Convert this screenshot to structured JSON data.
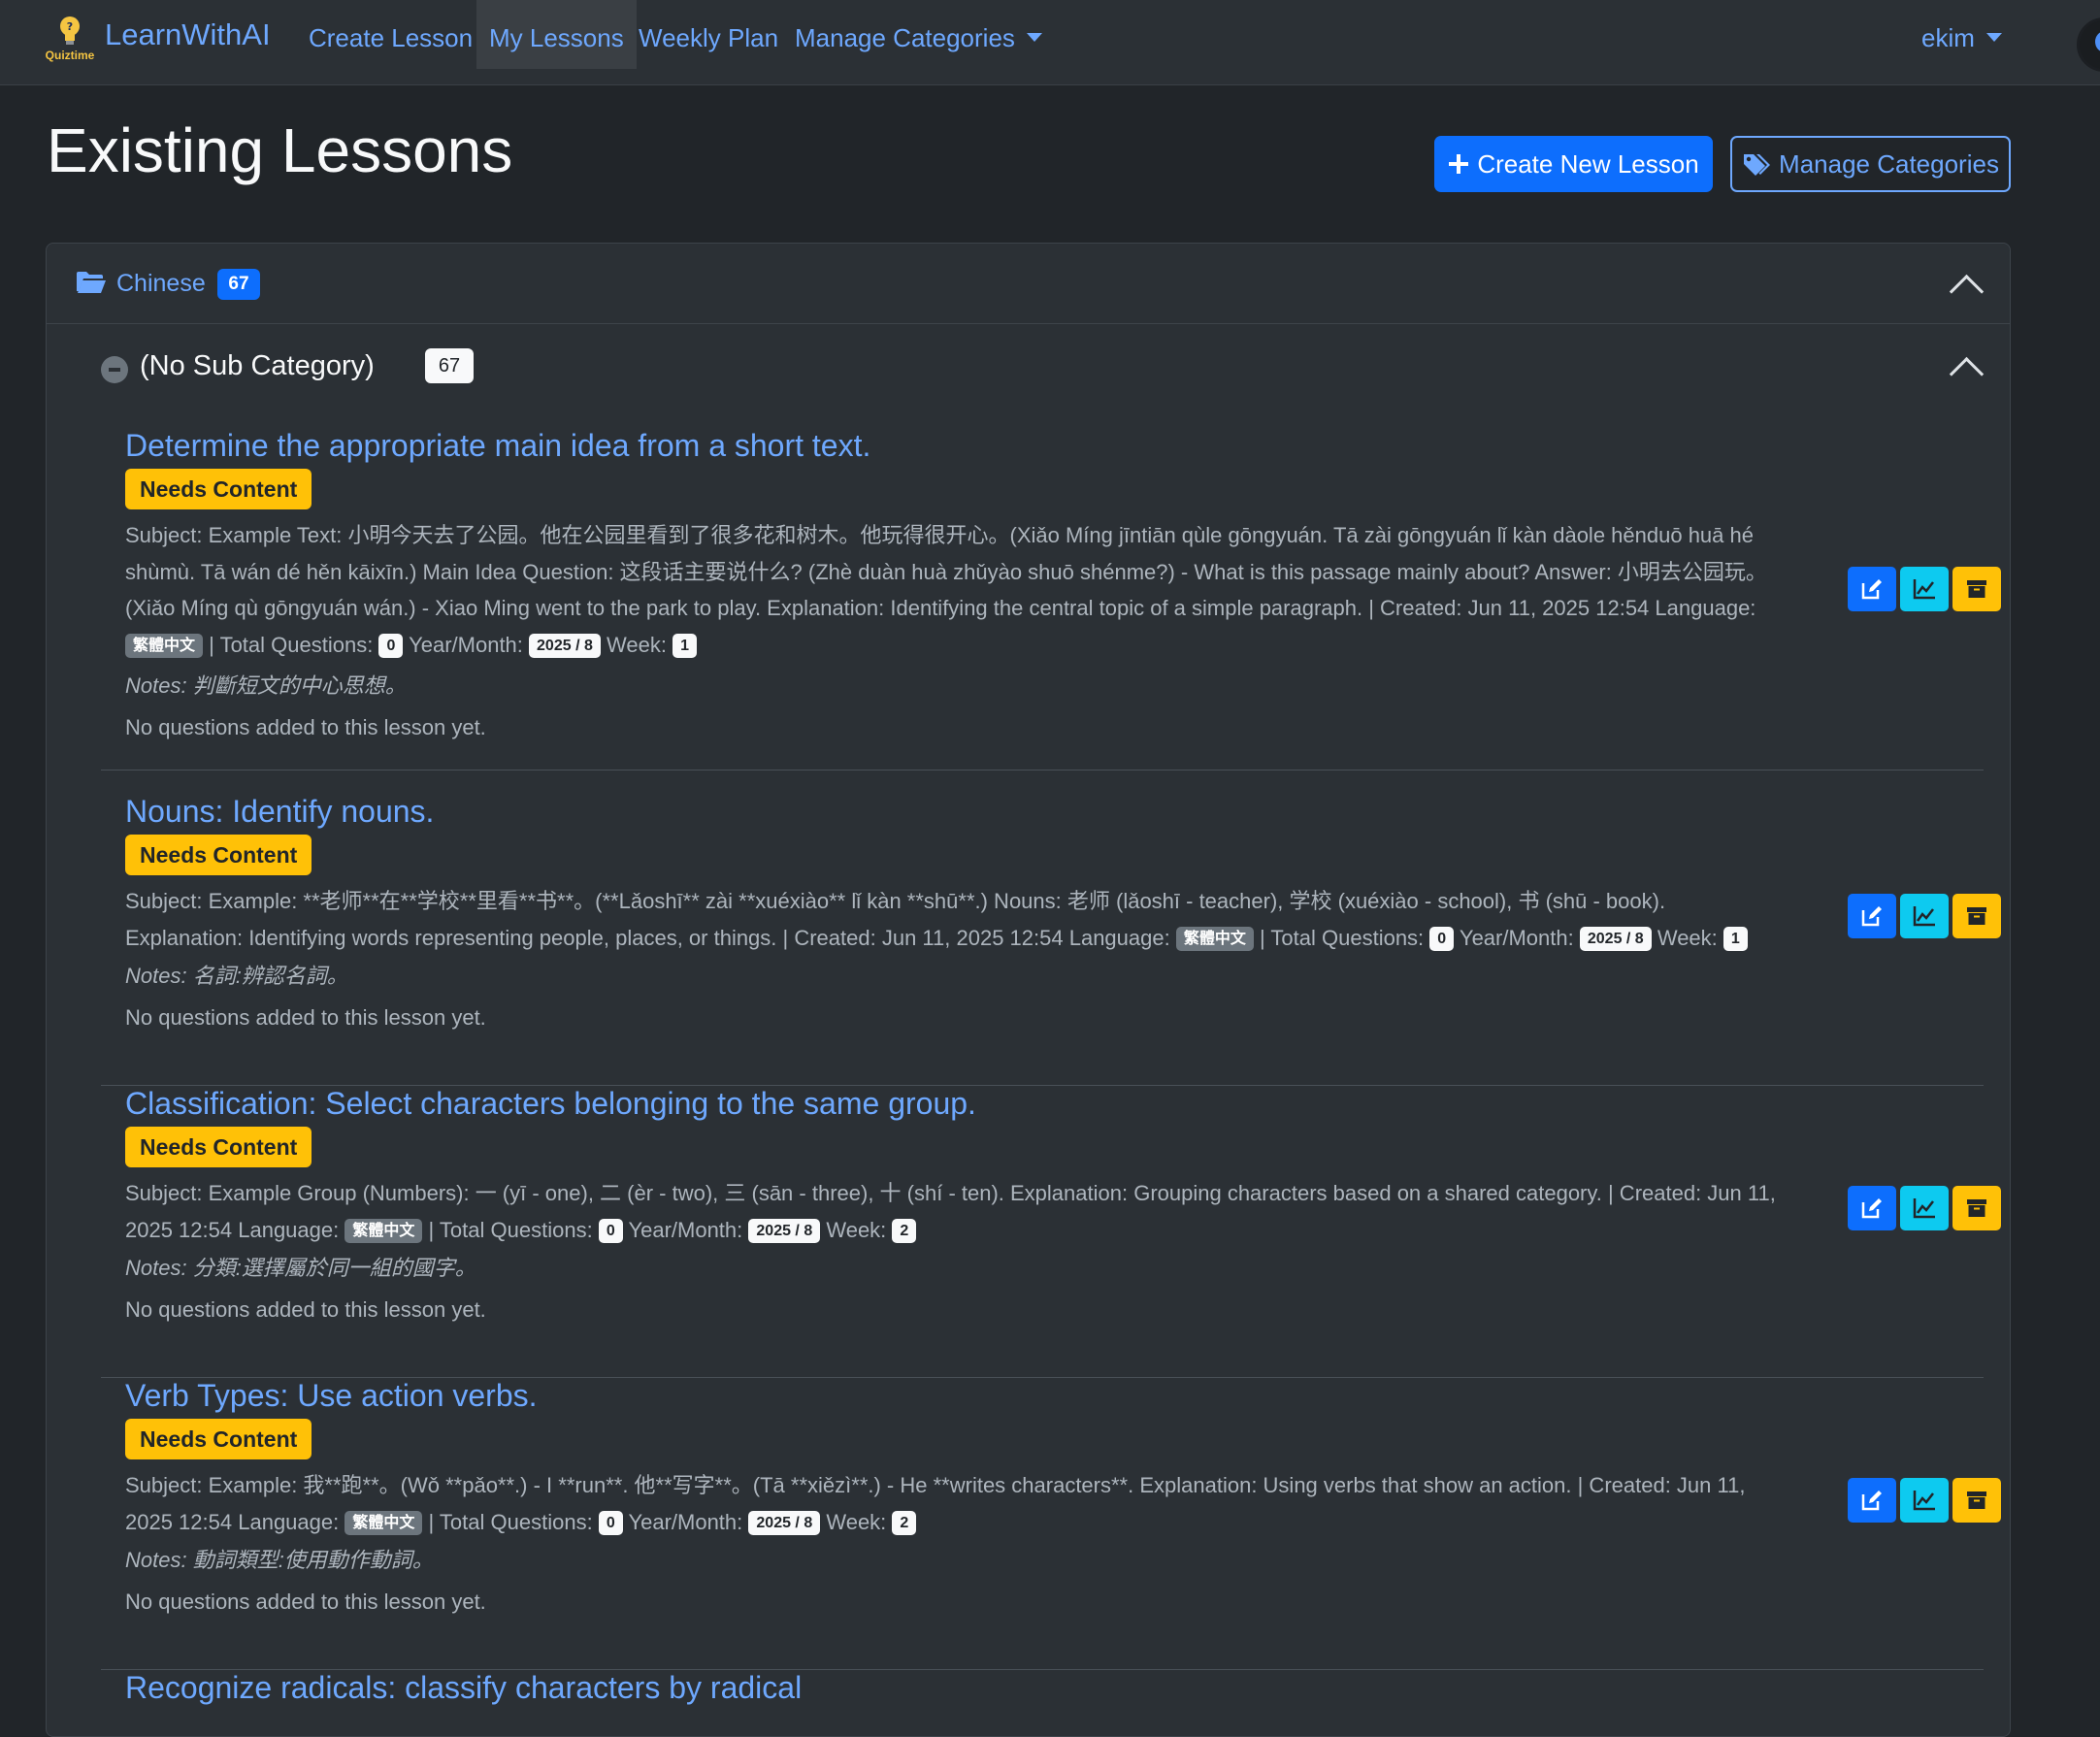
{
  "navbar": {
    "logo_text": "Quiztime",
    "brand": "LearnWithAI",
    "links": [
      "Create Lesson",
      "My Lessons",
      "Weekly Plan",
      "Manage Categories"
    ],
    "user": "ekim"
  },
  "page": {
    "title": "Existing Lessons",
    "create_button": "Create New Lesson",
    "manage_button": "Manage Categories"
  },
  "category": {
    "name": "Chinese",
    "count": "67",
    "subcategory": {
      "name": "(No Sub Category)",
      "count": "67"
    }
  },
  "labels": {
    "needs_content": "Needs Content",
    "total_questions": "| Total Questions:",
    "year_month": "Year/Month:",
    "week": "Week:",
    "language": "Language:",
    "no_questions": "No questions added to this lesson yet."
  },
  "lessons": [
    {
      "title": "Determine the appropriate main idea from a short text.",
      "body": "Subject: Example Text: 小明今天去了公园。他在公园里看到了很多花和树木。他玩得很开心。(Xiǎo Míng jīntiān qùle gōngyuán. Tā zài gōngyuán lǐ kàn dàole hěnduō huā hé shùmù. Tā wán dé hěn kāixīn.) Main Idea Question: 这段话主要说什么? (Zhè duàn huà zhǔyào shuō shénme?) - What is this passage mainly about? Answer: 小明去公园玩。(Xiǎo Míng qù gōngyuán wán.) - Xiao Ming went to the park to play. Explanation: Identifying the central topic of a simple paragraph. | Created: Jun 11, 2025 12:54",
      "language": "繁體中文",
      "total_questions": "0",
      "year_month": "2025 / 8",
      "week": "1",
      "notes": "Notes: 判斷短文的中心思想。"
    },
    {
      "title": "Nouns: Identify nouns.",
      "body": "Subject: Example: **老师**在**学校**里看**书**。(**Lǎoshī** zài **xuéxiào** lǐ kàn **shū**.) Nouns: 老师 (lǎoshī - teacher), 学校 (xuéxiào - school), 书 (shū - book). Explanation: Identifying words representing people, places, or things. | Created: Jun 11, 2025 12:54",
      "language": "繁體中文",
      "total_questions": "0",
      "year_month": "2025 / 8",
      "week": "1",
      "notes": "Notes: 名詞:辨認名詞。"
    },
    {
      "title": "Classification: Select characters belonging to the same group.",
      "body": "Subject: Example Group (Numbers): 一 (yī - one), 二 (èr - two), 三 (sān - three), 十 (shí - ten). Explanation: Grouping characters based on a shared category. | Created: Jun 11, 2025 12:54",
      "language": "繁體中文",
      "total_questions": "0",
      "year_month": "2025 / 8",
      "week": "2",
      "notes": "Notes: 分類:選擇屬於同一組的國字。"
    },
    {
      "title": "Verb Types: Use action verbs.",
      "body": "Subject: Example: 我**跑**。(Wǒ **pǎo**.) - I **run**. 他**写字**。(Tā **xiězì**.) - He **writes characters**. Explanation: Using verbs that show an action. | Created: Jun 11, 2025 12:54",
      "language": "繁體中文",
      "total_questions": "0",
      "year_month": "2025 / 8",
      "week": "2",
      "notes": "Notes: 動詞類型:使用動作動詞。"
    },
    {
      "title": "Recognize radicals: classify characters by radical"
    }
  ],
  "icons": {
    "edit": "edit-icon",
    "stats": "chart-line-icon",
    "archive": "archive-icon",
    "folder": "folder-open-icon",
    "tags": "tags-icon",
    "plus": "plus-icon"
  },
  "colors": {
    "background": "#212529",
    "navbar": "#2b3035",
    "link": "#6ea8fe",
    "primary": "#0d6efd",
    "info": "#0dcaf0",
    "warning": "#ffc107"
  }
}
